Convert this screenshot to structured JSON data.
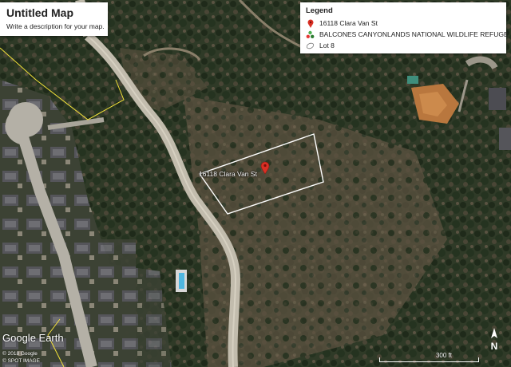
{
  "map": {
    "title": "Untitled Map",
    "description": "Write a description for your map."
  },
  "legend": {
    "heading": "Legend",
    "items": [
      {
        "label": "16118 Clara Van St",
        "icon": "red-pin-icon",
        "color": "#d93025"
      },
      {
        "label": "BALCONES CANYONLANDS NATIONAL WILDLIFE REFUGE",
        "icon": "cluster-icon",
        "color": "#4caf50"
      },
      {
        "label": "Lot 8",
        "icon": "polygon-icon",
        "color": "#ffffff"
      }
    ]
  },
  "markers": {
    "pin_label": "16118 Clara Van St"
  },
  "overlay": {
    "logo_text": "Google Earth",
    "copyright_line1": "© 2018 Google",
    "copyright_line2": "© SPOT IMAGE"
  },
  "scale": {
    "label": "300 ft"
  },
  "compass": {
    "label": "N"
  },
  "colors": {
    "lot_outline": "#ffffff",
    "refuge_boundary": "#f5e33a",
    "pin": "#d93025",
    "road": "#b9b3a4"
  }
}
